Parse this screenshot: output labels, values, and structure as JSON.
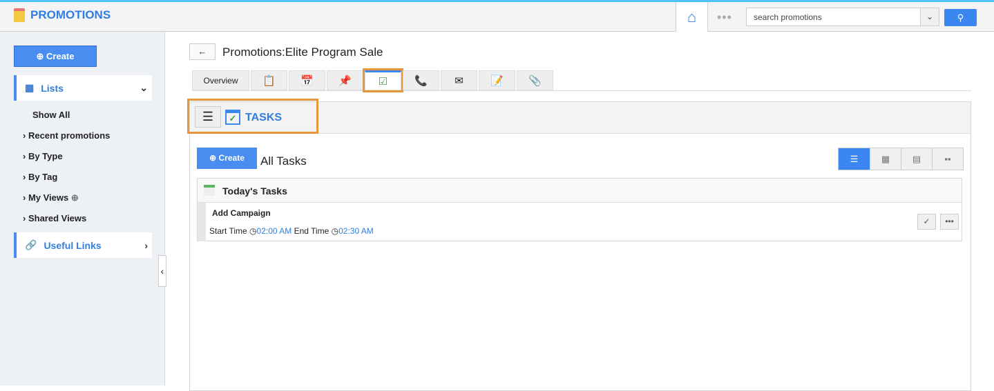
{
  "app": {
    "title": "PROMOTIONS"
  },
  "search": {
    "placeholder": "search promotions"
  },
  "sidebar": {
    "create": "Create",
    "lists": "Lists",
    "items": [
      "Show All",
      "Recent promotions",
      "By Type",
      "By Tag",
      "My Views",
      "Shared Views"
    ],
    "useful_links": "Useful Links"
  },
  "main": {
    "title": "Promotions:Elite Program Sale",
    "tabs": [
      "Overview"
    ],
    "section": "TASKS",
    "create": "Create",
    "heading": "All Tasks",
    "group": "Today's Tasks",
    "task": {
      "name": "Add Campaign",
      "start_label": "Start Time",
      "start": "02:00 AM",
      "end_label": "End Time",
      "end": "02:30 AM"
    }
  }
}
